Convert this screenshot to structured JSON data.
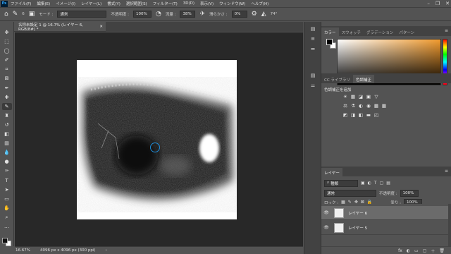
{
  "menubar": {
    "logo": "Ps",
    "items": [
      "ファイル(F)",
      "編集(E)",
      "イメージ(I)",
      "レイヤー(L)",
      "書式(Y)",
      "選択範囲(S)",
      "フィルター(T)",
      "3D(D)",
      "表示(V)",
      "ウィンドウ(W)",
      "ヘルプ(H)"
    ],
    "controls": [
      "–",
      "❐",
      "✕"
    ]
  },
  "options": {
    "mode_label": "モード :",
    "mode_value": "通常",
    "opacity_label": "不透明度 :",
    "opacity_value": "100%",
    "flow_label": "流量 :",
    "flow_value": "38%",
    "smoothing_label": "滑らかさ :",
    "smoothing_value": "0%",
    "angle_value": "74°",
    "brush_size": "6"
  },
  "document": {
    "tab_title": "名称未設定 1 @ 16.7% (レイヤー 6, RGB/8#) *",
    "close": "✕"
  },
  "status": {
    "zoom": "16.67%",
    "info": "4096 px x 4096 px (300 ppi)",
    "arrow": "›"
  },
  "panels": {
    "color_tabs": [
      "カラー",
      "スウォッチ",
      "グラデーション",
      "パターン"
    ],
    "adjust_tabs": [
      "CC ライブラリ",
      "色調補正"
    ],
    "adjust_title": "色調補正を追加",
    "adjust_row1": [
      "☀",
      "▦",
      "◪",
      "▣",
      "▽"
    ],
    "adjust_row2": [
      "⚖",
      "⚗",
      "◐",
      "◉",
      "▦",
      "▦"
    ],
    "adjust_row3": [
      "◩",
      "◨",
      "◧",
      "▬",
      "◰"
    ],
    "layers_tab": "レイヤー",
    "kind_label": "種類",
    "blend_mode": "通常",
    "opacity_label": "不透明度 :",
    "opacity_value": "100%",
    "lock_label": "ロック :",
    "fill_label": "塗り :",
    "fill_value": "100%",
    "layers": [
      {
        "name": "レイヤー 6",
        "selected": true
      },
      {
        "name": "レイヤー 5",
        "selected": false
      }
    ],
    "footer_icons": [
      "fx",
      "◐",
      "▭",
      "▢",
      "＋",
      "🗑"
    ]
  },
  "colors": {
    "accent": "#1e8bd6",
    "picker_hue": "#f29b2e"
  }
}
